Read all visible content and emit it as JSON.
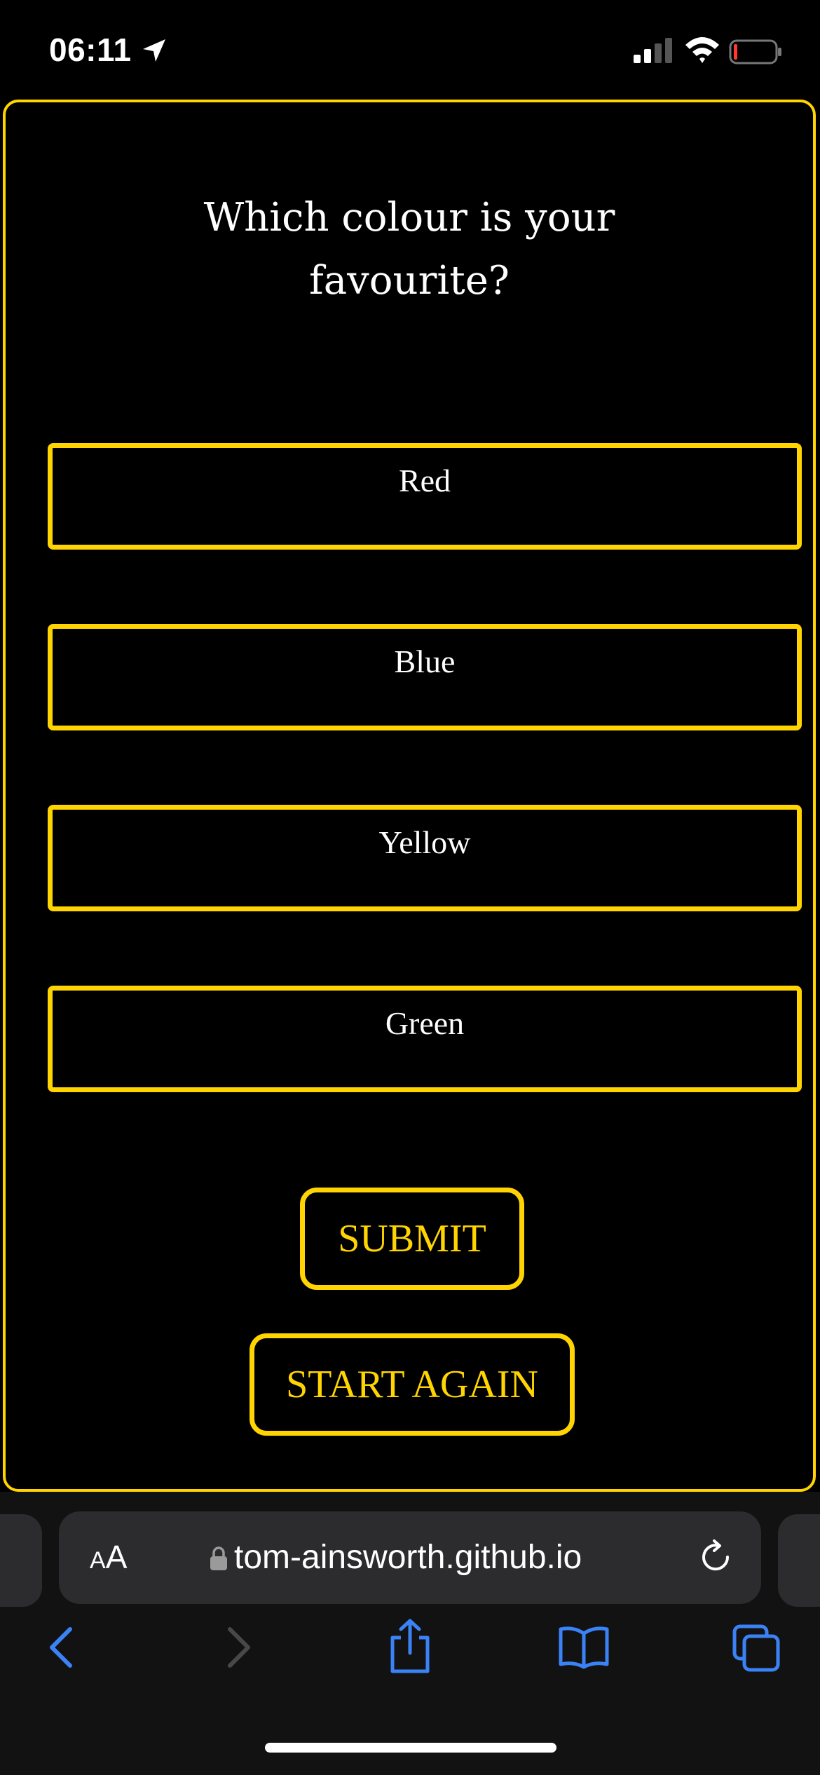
{
  "status_bar": {
    "time": "06:11"
  },
  "quiz": {
    "question": "Which colour is your favourite?",
    "options": [
      {
        "label": "Red"
      },
      {
        "label": "Blue"
      },
      {
        "label": "Yellow"
      },
      {
        "label": "Green"
      }
    ],
    "submit_label": "SUBMIT",
    "restart_label": "START AGAIN"
  },
  "browser": {
    "aa_small": "A",
    "aa_large": "A",
    "url": "tom-ainsworth.github.io"
  },
  "colors": {
    "background": "#000000",
    "accent": "#ffd400",
    "text": "#ffffff",
    "toolbar": "#121212",
    "url_bar": "#2c2c2e",
    "ios_blue": "#3b82f6"
  },
  "icons": [
    "location-icon",
    "signal-icon",
    "wifi-icon",
    "battery-icon",
    "lock-icon",
    "reload-icon",
    "back-icon",
    "forward-icon",
    "share-icon",
    "bookmarks-icon",
    "tabs-icon"
  ]
}
